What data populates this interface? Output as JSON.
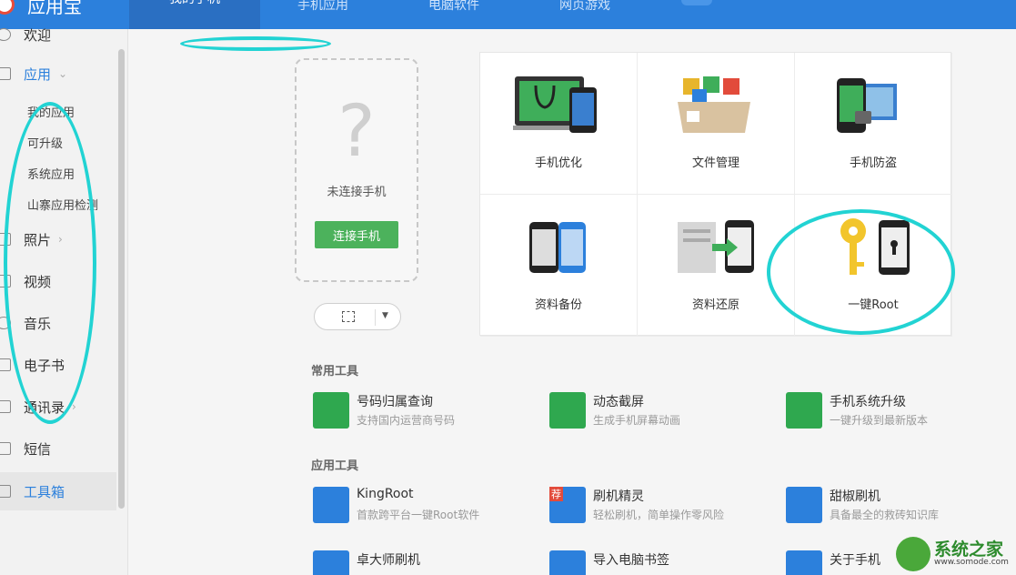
{
  "app": {
    "title": "应用宝"
  },
  "tabs": [
    "我的手机",
    "手机应用",
    "电脑软件",
    "网页游戏"
  ],
  "sidebar": {
    "items": [
      {
        "label": "欢迎"
      },
      {
        "label": "应用",
        "chevron": "⌄"
      },
      {
        "label": "照片",
        "chevron": "›"
      },
      {
        "label": "视频"
      },
      {
        "label": "音乐"
      },
      {
        "label": "电子书"
      },
      {
        "label": "通讯录",
        "chevron": "›"
      },
      {
        "label": "短信"
      },
      {
        "label": "工具箱"
      }
    ],
    "sub_items": [
      "我的应用",
      "可升级",
      "系统应用",
      "山寨应用检测"
    ]
  },
  "phone": {
    "status": "未连接手机",
    "connect_label": "连接手机",
    "placeholder_glyph": "?"
  },
  "grid": [
    {
      "label": "手机优化",
      "icon": "phone-optimize-icon"
    },
    {
      "label": "文件管理",
      "icon": "file-manager-icon"
    },
    {
      "label": "手机防盗",
      "icon": "anti-theft-icon"
    },
    {
      "label": "资料备份",
      "icon": "data-backup-icon"
    },
    {
      "label": "资料还原",
      "icon": "data-restore-icon"
    },
    {
      "label": "一键Root",
      "icon": "key-root-icon"
    }
  ],
  "sections": {
    "common": "常用工具",
    "apps": "应用工具"
  },
  "common_tools": [
    {
      "name": "号码归属查询",
      "desc": "支持国内运营商号码",
      "color": "#2fa84f"
    },
    {
      "name": "动态截屏",
      "desc": "生成手机屏幕动画",
      "color": "#2fa84f"
    },
    {
      "name": "手机系统升级",
      "desc": "一键升级到最新版本",
      "color": "#2fa84f"
    }
  ],
  "app_tools": [
    {
      "name": "KingRoot",
      "desc": "首款跨平台一键Root软件",
      "color": "#2c80dc"
    },
    {
      "name": "刷机精灵",
      "desc": "轻松刷机，简单操作零风险",
      "color": "#2c80dc",
      "badge": "荐"
    },
    {
      "name": "甜椒刷机",
      "desc": "具备最全的救砖知识库",
      "color": "#2c80dc"
    },
    {
      "name": "卓大师刷机",
      "desc": "",
      "color": "#2c80dc"
    },
    {
      "name": "导入电脑书签",
      "desc": "",
      "color": "#2c80dc"
    },
    {
      "name": "关于手机",
      "desc": "",
      "color": "#2c80dc"
    }
  ],
  "watermark": {
    "name": "系统之家",
    "url": "www.somode.com"
  },
  "colors": {
    "accent": "#2c80dc",
    "green": "#4cb25c",
    "annotation": "#22d3d3"
  }
}
